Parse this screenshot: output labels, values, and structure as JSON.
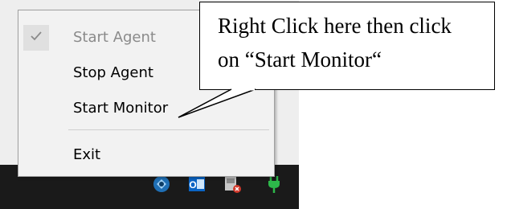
{
  "context_menu": {
    "items": [
      {
        "label": "Start Agent",
        "checked": true,
        "disabled": true
      },
      {
        "label": "Stop Agent",
        "checked": false,
        "disabled": false
      },
      {
        "label": "Start Monitor",
        "checked": false,
        "disabled": false
      },
      {
        "label": "Exit",
        "checked": false,
        "disabled": false
      }
    ]
  },
  "callout": {
    "line1": "Right Click here then click",
    "line2": "on “Start Monitor“"
  },
  "taskbar": {
    "tray_icons": [
      "agent-app-icon",
      "outlook-icon",
      "device-icon",
      "power-plug-icon"
    ]
  },
  "colors": {
    "menu_bg": "#f2f2f2",
    "taskbar_bg": "#1a1a1a",
    "disabled_text": "#8a8a8a"
  }
}
